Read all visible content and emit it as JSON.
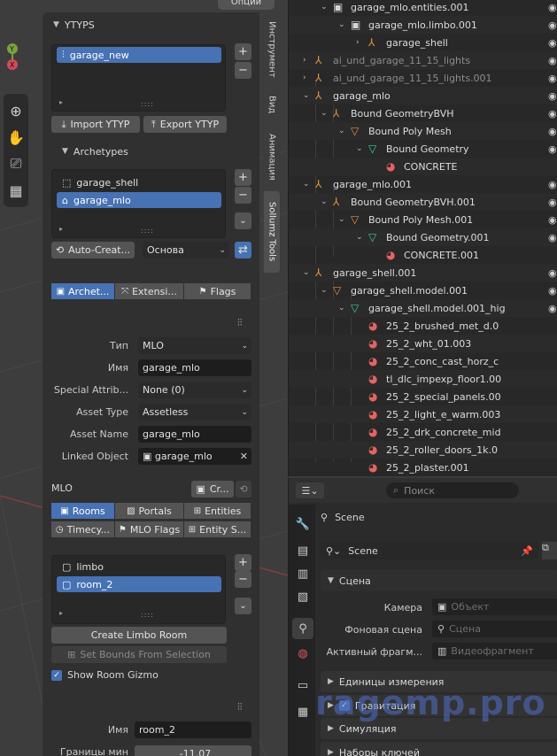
{
  "options_label": "Опции",
  "vtabs": [
    "Инструмент",
    "Вид",
    "Анимация",
    "Sollumz Tools"
  ],
  "ytyps": {
    "title": "YTYPS",
    "items": [
      "garage_new"
    ],
    "import_label": "Import YTYP",
    "export_label": "Export YTYP"
  },
  "archetypes": {
    "title": "Archetypes",
    "items": [
      "garage_shell",
      "garage_mlo"
    ],
    "auto_create_label": "Auto-Creat...",
    "dropdown_value": "Основа"
  },
  "arch_tabs": [
    "Archet...",
    "Extensi...",
    "Flags"
  ],
  "fields": {
    "type_label": "Тип",
    "type_value": "MLO",
    "name_label": "Имя",
    "name_value": "garage_mlo",
    "special_label": "Special Attrib...",
    "special_value": "None (0)",
    "asset_type_label": "Asset Type",
    "asset_type_value": "Assetless",
    "asset_name_label": "Asset Name",
    "asset_name_value": "garage_mlo",
    "linked_label": "Linked Object",
    "linked_value": "garage_mlo"
  },
  "mlo": {
    "title": "MLO",
    "create_label": "Cr...",
    "tabs_row1": [
      "Rooms",
      "Portals",
      "Entities"
    ],
    "tabs_row2": [
      "Timecy...",
      "MLO Flags",
      "Entity S..."
    ],
    "rooms": [
      "limbo",
      "room_2"
    ],
    "create_limbo_label": "Create Limbo Room",
    "set_bounds_label": "Set Bounds From Selection",
    "show_gizmo_label": "Show Room Gizmo",
    "room_name_label": "Имя",
    "room_name_value": "room_2",
    "cut_label": "Границы мин",
    "cut_value": "-11.07"
  },
  "outliner": [
    {
      "text": "garage_mlo.entities.001",
      "indent": 2,
      "icon": "collection",
      "dim": false
    },
    {
      "text": "garage_mlo.limbo.001",
      "indent": 3,
      "icon": "collection",
      "dim": false
    },
    {
      "text": "garage_shell",
      "indent": 4,
      "icon": "object",
      "dim": false
    },
    {
      "text": "ai_und_garage_11_15_lights",
      "indent": 1,
      "icon": "object",
      "dim": true
    },
    {
      "text": "ai_und_garage_11_15_lights.001",
      "indent": 1,
      "icon": "object",
      "dim": true
    },
    {
      "text": "garage_mlo",
      "indent": 1,
      "icon": "object",
      "dim": false
    },
    {
      "text": "Bound GeometryBVH",
      "indent": 2,
      "icon": "object",
      "dim": false
    },
    {
      "text": "Bound Poly Mesh",
      "indent": 3,
      "icon": "mesh",
      "dim": false
    },
    {
      "text": "Bound Geometry",
      "indent": 4,
      "icon": "meshdata",
      "dim": false
    },
    {
      "text": "CONCRETE",
      "indent": 5,
      "icon": "material",
      "dim": false
    },
    {
      "text": "garage_mlo.001",
      "indent": 1,
      "icon": "object",
      "dim": false
    },
    {
      "text": "Bound GeometryBVH.001",
      "indent": 2,
      "icon": "object",
      "dim": false
    },
    {
      "text": "Bound Poly Mesh.001",
      "indent": 3,
      "icon": "mesh",
      "dim": false
    },
    {
      "text": "Bound Geometry.001",
      "indent": 4,
      "icon": "meshdata",
      "dim": false
    },
    {
      "text": "CONCRETE.001",
      "indent": 5,
      "icon": "material",
      "dim": false
    },
    {
      "text": "garage_shell.001",
      "indent": 1,
      "icon": "object",
      "dim": false
    },
    {
      "text": "garage_shell.model.001",
      "indent": 2,
      "icon": "mesh",
      "dim": false
    },
    {
      "text": "garage_shell.model.001_hig",
      "indent": 3,
      "icon": "meshdata",
      "dim": false
    },
    {
      "text": "25_2_brushed_met_d.0",
      "indent": 4,
      "icon": "material",
      "dim": false
    },
    {
      "text": "25_2_wht_01.003",
      "indent": 4,
      "icon": "material",
      "dim": false
    },
    {
      "text": "25_2_conc_cast_horz_c",
      "indent": 4,
      "icon": "material",
      "dim": false
    },
    {
      "text": "tl_dlc_impexp_floor1.00",
      "indent": 4,
      "icon": "material",
      "dim": false
    },
    {
      "text": "25_2_special_panels.00",
      "indent": 4,
      "icon": "material",
      "dim": false
    },
    {
      "text": "25_2_light_e_warm.003",
      "indent": 4,
      "icon": "material",
      "dim": false
    },
    {
      "text": "25_2_drk_concrete_mid",
      "indent": 4,
      "icon": "material",
      "dim": false
    },
    {
      "text": "25_2_roller_doors_1k.0",
      "indent": 4,
      "icon": "material",
      "dim": false
    },
    {
      "text": "25_2_plaster.001",
      "indent": 4,
      "icon": "material",
      "dim": false
    }
  ],
  "props": {
    "search_placeholder": "Поиск",
    "context_label": "Scene",
    "scene_field": "Scene",
    "scene_section": "Сцена",
    "camera_label": "Камера",
    "camera_placeholder": "Объект",
    "bg_label": "Фоновая сцена",
    "bg_placeholder": "Сцена",
    "clip_label": "Активный фрагм...",
    "clip_placeholder": "Видеофрагмент",
    "sections": [
      "Единицы измерения",
      "Гравитация",
      "Симуляция",
      "Наборы ключей"
    ]
  },
  "watermark": "ragemp.pro",
  "colors": {
    "accent": "#4772b3",
    "orange": "#e8913a",
    "teal": "#3fc9a8",
    "material": "#e66363"
  }
}
